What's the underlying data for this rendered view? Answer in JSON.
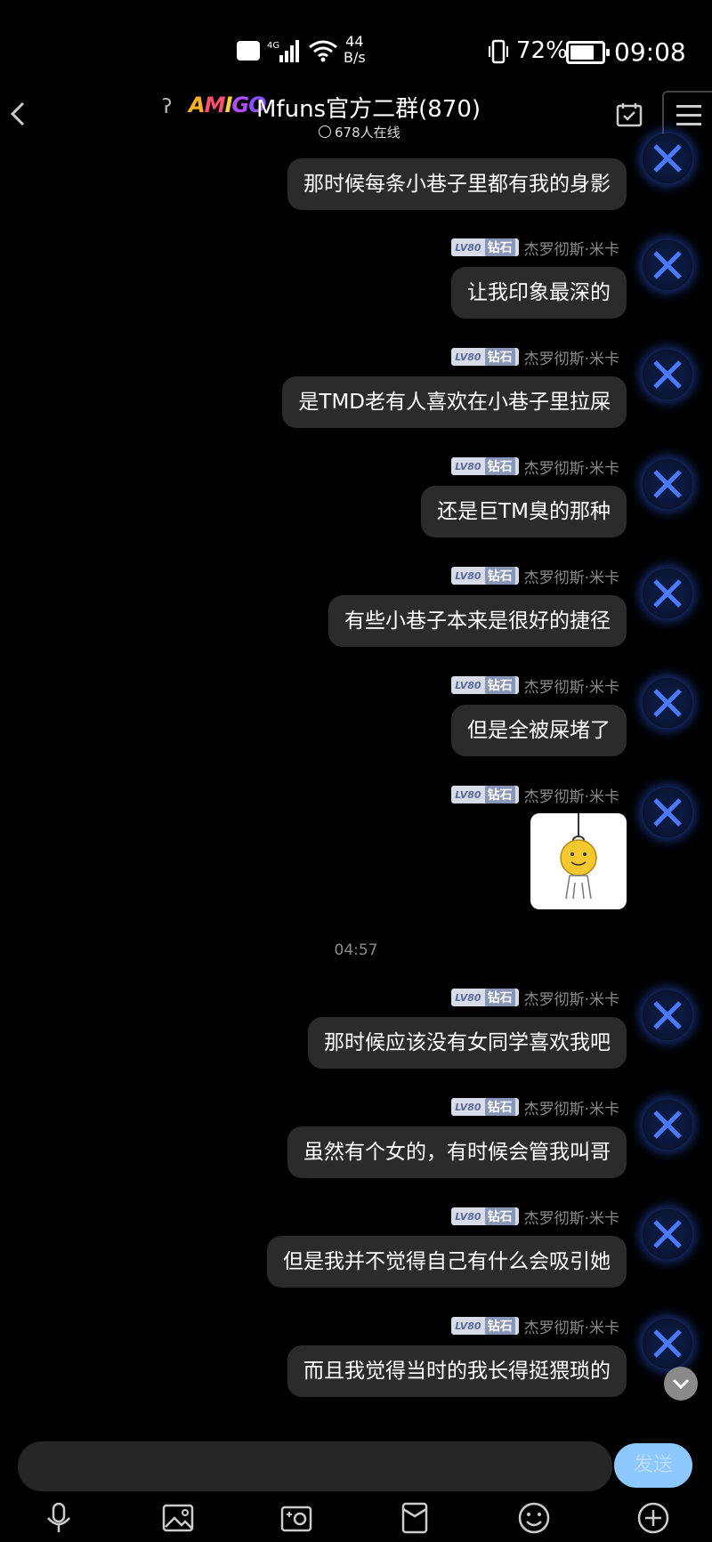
{
  "status_bar": {
    "network": "4G",
    "speed_value": "44",
    "speed_unit": "B/s",
    "battery": "72%",
    "time": "09:08"
  },
  "header": {
    "logo_text": "AMIGO",
    "group_name": "Mfuns官方二群(870)",
    "online_count": "678人在线"
  },
  "sender": {
    "level": "LV80",
    "rank": "钻石",
    "name": "杰罗彻斯·米卡"
  },
  "messages": [
    {
      "text": "那时候每条小巷子里都有我的身影"
    },
    {
      "text": "让我印象最深的"
    },
    {
      "text": "是TMD老有人喜欢在小巷子里拉屎"
    },
    {
      "text": "还是巨TM臭的那种"
    },
    {
      "text": "有些小巷子本来是很好的捷径"
    },
    {
      "text": "但是全被屎堵了"
    },
    {
      "sticker": "hanging-smiley-sticker"
    },
    {
      "text": "那时候应该没有女同学喜欢我吧"
    },
    {
      "text": "虽然有个女的，有时候会管我叫哥"
    },
    {
      "text": "但是我并不觉得自己有什么会吸引她"
    },
    {
      "text": "而且我觉得当时的我长得挺猥琐的"
    }
  ],
  "timestamp": "04:57",
  "composer": {
    "placeholder": "",
    "send_label": "发送"
  },
  "colors": {
    "bubble": "#2b2b2b",
    "send_button": "#8cc8ff",
    "background": "#000000"
  }
}
